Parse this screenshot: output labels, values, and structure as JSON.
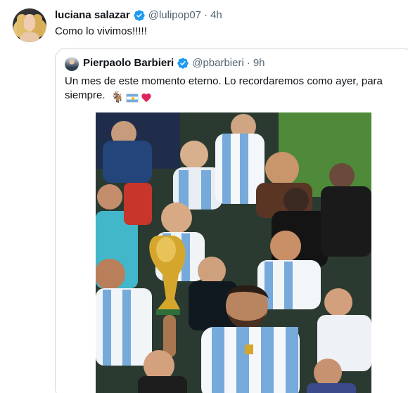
{
  "tweet": {
    "author_name": "luciana salazar",
    "author_handle": "@lulipop07",
    "separator": "·",
    "time": "4h",
    "text": "Como lo vivimos!!!!!",
    "verified_color": "#1d9bf0"
  },
  "quoted_tweet": {
    "author_name": "Pierpaolo Barbieri",
    "author_handle": "@pbarbieri",
    "separator": "·",
    "time": "9h",
    "text": "Un mes de este momento eterno. Lo recordaremos como ayer, para siempre.",
    "emojis": [
      "goat-icon",
      "argentina-flag-icon",
      "red-heart-icon"
    ],
    "heart_color": "#e0245e",
    "image_description_icon": "celebration-photo"
  },
  "colors": {
    "text_primary": "#0f1419",
    "text_secondary": "#536471",
    "border": "#cfd9de",
    "jersey_blue": "#75aadb",
    "trophy_gold": "#d4a72c"
  }
}
